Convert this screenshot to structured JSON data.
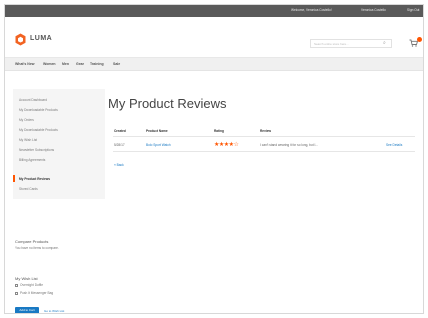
{
  "topbar": {
    "welcome": "Welcome, Veronica Costello!",
    "account": "Veronica Costello",
    "signout": "Sign Out"
  },
  "header": {
    "logo_text": "LUMA",
    "search_placeholder": "Search entire store here..."
  },
  "nav": {
    "items": [
      "What's New",
      "Women",
      "Men",
      "Gear",
      "Training",
      "Sale"
    ]
  },
  "sidebar": {
    "items": [
      "Account Dashboard",
      "My Downloadable Products",
      "My Orders",
      "My Downloadable Products",
      "My Wish List",
      "Newsletter Subscriptions",
      "Billing Agreements",
      "My Product Reviews",
      "Stored Cards"
    ],
    "active_index": 7
  },
  "compare": {
    "title": "Compare Products",
    "text": "You have no items to compare."
  },
  "wishlist": {
    "title": "My Wish List",
    "items": [
      "Overnight Duffle",
      "Push It Messenger Bag"
    ],
    "add_button": "Add to Cart",
    "view_all": "Go to Wish List"
  },
  "main": {
    "title": "My Product Reviews",
    "columns": [
      "Created",
      "Product Name",
      "Rating",
      "Review"
    ],
    "rows": [
      {
        "created": "5/28/17",
        "product": "Bolo Sport Watch",
        "rating": "★★★★☆",
        "review": "I can't stand wearing it for so long, but I...",
        "action": "See Details"
      }
    ],
    "back": "« Back"
  }
}
